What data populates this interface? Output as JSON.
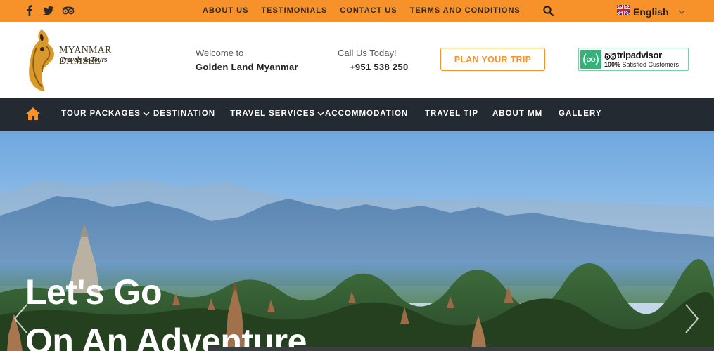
{
  "topbar": {
    "social": [
      "facebook-icon",
      "twitter-icon",
      "tripadvisor-icon"
    ],
    "links": [
      "ABOUT US",
      "TESTIMONIALS",
      "CONTACT US",
      "TERMS AND CONDITIONS"
    ],
    "language": "English"
  },
  "header": {
    "logo_brand": "MYANMAR DAMSEL",
    "logo_sub": "Travels & Tours",
    "welcome_line1": "Welcome to",
    "welcome_line2": "Golden Land Myanmar",
    "call_line1": "Call Us Today!",
    "call_line2": "+951 538 250",
    "plan_button": "PLAN YOUR TRIP",
    "badge_name": "tripadvisor",
    "badge_tag_bold": "100%",
    "badge_tag_rest": " Satisfied Customers"
  },
  "nav": {
    "items": [
      "TOUR PACKAGES",
      "DESTINATION",
      "TRAVEL SERVICES",
      "ACCOMMODATION",
      "TRAVEL TIP",
      "ABOUT MM",
      "GALLERY"
    ]
  },
  "hero": {
    "line1": "Let's Go",
    "line2": "On An Adventure"
  },
  "colors": {
    "accent": "#f7922b",
    "nav_bg": "#232a31",
    "tripadvisor_green": "#34b27a"
  }
}
